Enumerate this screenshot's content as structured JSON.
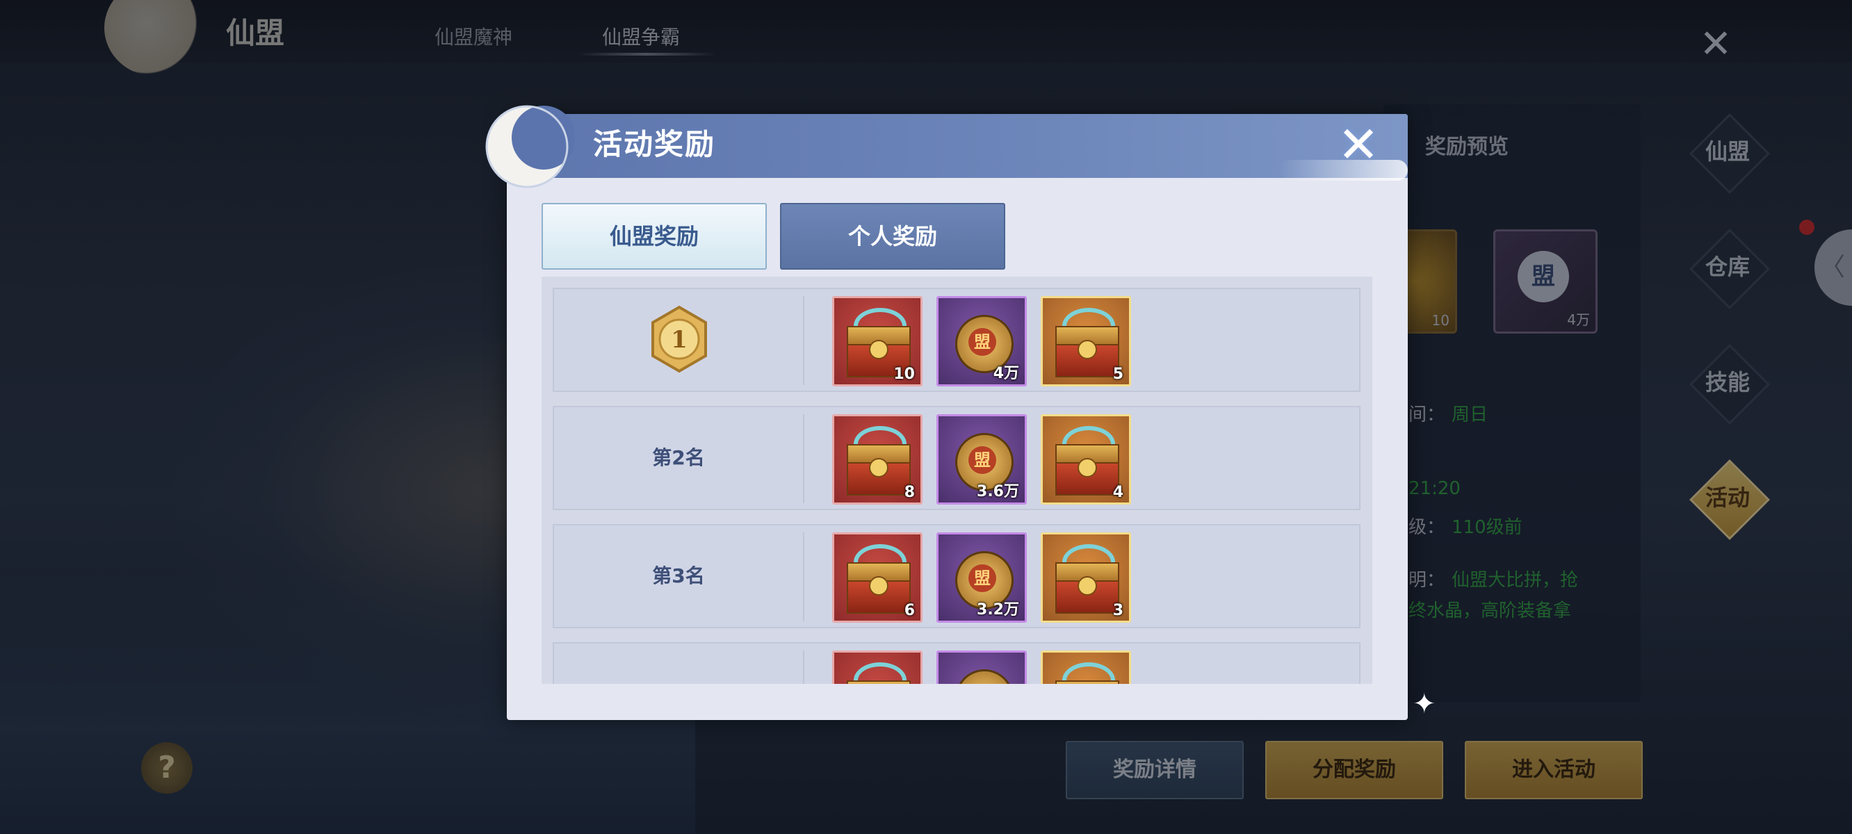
{
  "window": {
    "title": "仙盟"
  },
  "top_tabs": [
    {
      "label": "仙盟魔神"
    },
    {
      "label": "仙盟争霸"
    }
  ],
  "side_panel": {
    "header": "奖励预览",
    "items": [
      {
        "count": "10",
        "glyph": ""
      },
      {
        "count": "4万",
        "glyph": "盟"
      }
    ],
    "time_label": "间：",
    "time_value": "周日",
    "clock": "21:20",
    "level_label": "级：",
    "level_value": "110级前",
    "desc_label": "明：",
    "desc_line1": "仙盟大比拼，抢",
    "desc_line2": "终水晶，高阶装备拿"
  },
  "right_nav": [
    {
      "label": "仙盟"
    },
    {
      "label": "仓库"
    },
    {
      "label": "技能"
    },
    {
      "label": "活动"
    }
  ],
  "collapse_handle": "〈",
  "help": "?",
  "bottom_buttons": {
    "detail": "奖励详情",
    "distribute": "分配奖励",
    "enter": "进入活动"
  },
  "modal": {
    "title": "活动奖励",
    "close_glyph": "✕",
    "tabs": [
      {
        "label": "仙盟奖励",
        "active": true
      },
      {
        "label": "个人奖励",
        "active": false
      }
    ],
    "coin_glyph": "盟",
    "rows": [
      {
        "rank_label": "",
        "medal": "1",
        "items": [
          "10",
          "4万",
          "5"
        ]
      },
      {
        "rank_label": "第2名",
        "medal": "",
        "items": [
          "8",
          "3.6万",
          "4"
        ]
      },
      {
        "rank_label": "第3名",
        "medal": "",
        "items": [
          "6",
          "3.2万",
          "3"
        ]
      },
      {
        "rank_label": "",
        "medal": "",
        "items": [
          "",
          "",
          ""
        ]
      }
    ]
  }
}
